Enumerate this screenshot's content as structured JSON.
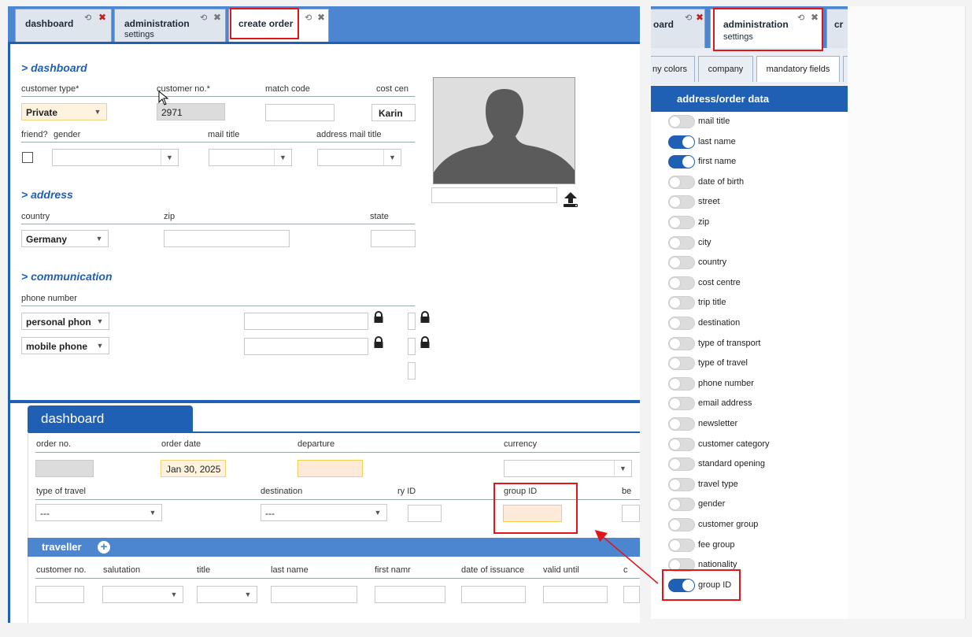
{
  "left_tabs": [
    {
      "title": "dashboard",
      "subtitle": ""
    },
    {
      "title": "administration",
      "subtitle": "settings"
    },
    {
      "title": "create order",
      "subtitle": ""
    }
  ],
  "right_tabs": [
    {
      "title": "oard"
    },
    {
      "title": "administration",
      "subtitle": "settings"
    },
    {
      "title": "cr"
    }
  ],
  "form": {
    "dashboard_section": "> dashboard",
    "customer_type_label": "customer type*",
    "customer_type_value": "Private",
    "customer_no_label": "customer no.*",
    "customer_no_value": "2971",
    "match_code_label": "match code",
    "cost_centre_label": "cost cen",
    "cost_centre_value": "Karin",
    "friend_label": "friend?",
    "gender_label": "gender",
    "mail_title_label": "mail title",
    "address_mail_title_label": "address mail title",
    "address_section": "> address",
    "country_label": "country",
    "country_value": "Germany",
    "zip_label": "zip",
    "state_label": "state",
    "communication_section": "> communication",
    "phone_number_label": "phone number",
    "phone_type_1": "personal phon",
    "phone_type_2": "mobile phone"
  },
  "order": {
    "tab_label": "dashboard",
    "order_no_label": "order no.",
    "order_date_label": "order date",
    "order_date_value": "Jan 30, 2025",
    "departure_label": "departure",
    "currency_label": "currency",
    "type_of_travel_label": "type of travel",
    "type_of_travel_value": "---",
    "destination_label": "destination",
    "destination_value": "---",
    "country_id_label": "ry ID",
    "group_id_label": "group ID",
    "cut_label": "be",
    "traveller_label": "traveller",
    "cols": [
      "customer no.",
      "salutation",
      "title",
      "last name",
      "first namr",
      "date of issuance",
      "valid until",
      "c"
    ]
  },
  "settings": {
    "subtabs": [
      "ny colors",
      "company",
      "mandatory fields"
    ],
    "section_title": "address/order data",
    "fields": [
      {
        "label": "mail title",
        "on": false
      },
      {
        "label": "last name",
        "on": true
      },
      {
        "label": "first name",
        "on": true
      },
      {
        "label": "date of birth",
        "on": false
      },
      {
        "label": "street",
        "on": false
      },
      {
        "label": "zip",
        "on": false
      },
      {
        "label": "city",
        "on": false
      },
      {
        "label": "country",
        "on": false
      },
      {
        "label": "cost centre",
        "on": false
      },
      {
        "label": "trip title",
        "on": false
      },
      {
        "label": "destination",
        "on": false
      },
      {
        "label": "type of transport",
        "on": false
      },
      {
        "label": "type of travel",
        "on": false
      },
      {
        "label": "phone number",
        "on": false
      },
      {
        "label": "email address",
        "on": false
      },
      {
        "label": "newsletter",
        "on": false
      },
      {
        "label": "customer category",
        "on": false
      },
      {
        "label": "standard opening",
        "on": false
      },
      {
        "label": "travel type",
        "on": false
      },
      {
        "label": "gender",
        "on": false
      },
      {
        "label": "customer group",
        "on": false
      },
      {
        "label": "fee group",
        "on": false
      },
      {
        "label": "nationality",
        "on": false
      },
      {
        "label": "group ID",
        "on": true
      }
    ]
  },
  "colors": {
    "accent": "#1f5fb4",
    "tabbar": "#4c86d0",
    "highlight": "#e0161b"
  }
}
